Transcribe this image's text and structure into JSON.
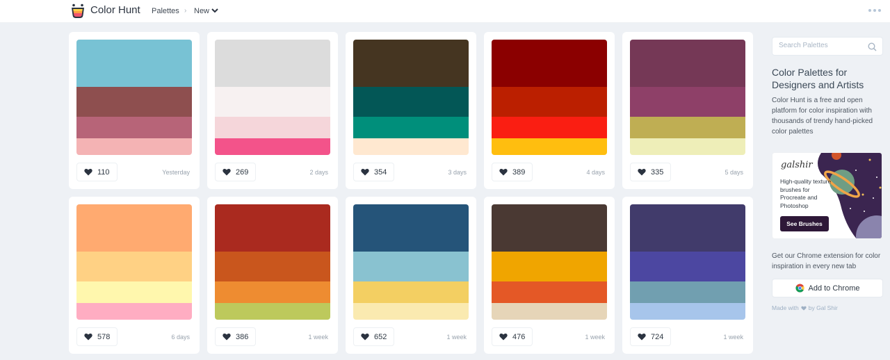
{
  "header": {
    "brand": "Color Hunt",
    "breadcrumb": [
      "Palettes",
      "New"
    ],
    "breadcrumb_separator": "›",
    "more_icon": "ellipsis-icon"
  },
  "palettes": [
    {
      "colors": [
        "#78c2d4",
        "#8e4f4f",
        "#b76478",
        "#f4b3b4"
      ],
      "likes": "110",
      "date": "Yesterday"
    },
    {
      "colors": [
        "#dcdcdc",
        "#f7f1f1",
        "#f5d6da",
        "#f3538a"
      ],
      "likes": "269",
      "date": "2 days"
    },
    {
      "colors": [
        "#453521",
        "#035756",
        "#008f7b",
        "#ffe8d0"
      ],
      "likes": "354",
      "date": "3 days"
    },
    {
      "colors": [
        "#8b0000",
        "#bb1f00",
        "#fa1e12",
        "#ffbe0f"
      ],
      "likes": "389",
      "date": "4 days"
    },
    {
      "colors": [
        "#753856",
        "#8e4068",
        "#bfae53",
        "#eeeeb8"
      ],
      "likes": "335",
      "date": "5 days"
    },
    {
      "colors": [
        "#ffaa70",
        "#ffd184",
        "#fff7ad",
        "#ffadc2"
      ],
      "likes": "578",
      "date": "6 days"
    },
    {
      "colors": [
        "#aa2a1f",
        "#c9561d",
        "#ee8c31",
        "#bdc95c"
      ],
      "likes": "386",
      "date": "1 week"
    },
    {
      "colors": [
        "#255479",
        "#89c2d0",
        "#f3cf62",
        "#faeab0"
      ],
      "likes": "652",
      "date": "1 week"
    },
    {
      "colors": [
        "#4a3933",
        "#f0a500",
        "#e45826",
        "#e6d5b8"
      ],
      "likes": "476",
      "date": "1 week"
    },
    {
      "colors": [
        "#413b6b",
        "#4c47a1",
        "#719fb0",
        "#a7c5eb"
      ],
      "likes": "724",
      "date": "1 week"
    }
  ],
  "sidebar": {
    "search_placeholder": "Search Palettes",
    "title": "Color Palettes for Designers and Artists",
    "description": "Color Hunt is a free and open platform for color inspiration with thousands of trendy hand-picked color palettes",
    "ad": {
      "signature": "galshir",
      "text": "High-quality texture brushes for Procreate and Photoshop",
      "button": "See Brushes"
    },
    "extension_text": "Get our Chrome extension for color inspiration in every new tab",
    "chrome_button": "Add to Chrome",
    "made_with_prefix": "Made with",
    "made_with_suffix": "by Gal Shir"
  }
}
